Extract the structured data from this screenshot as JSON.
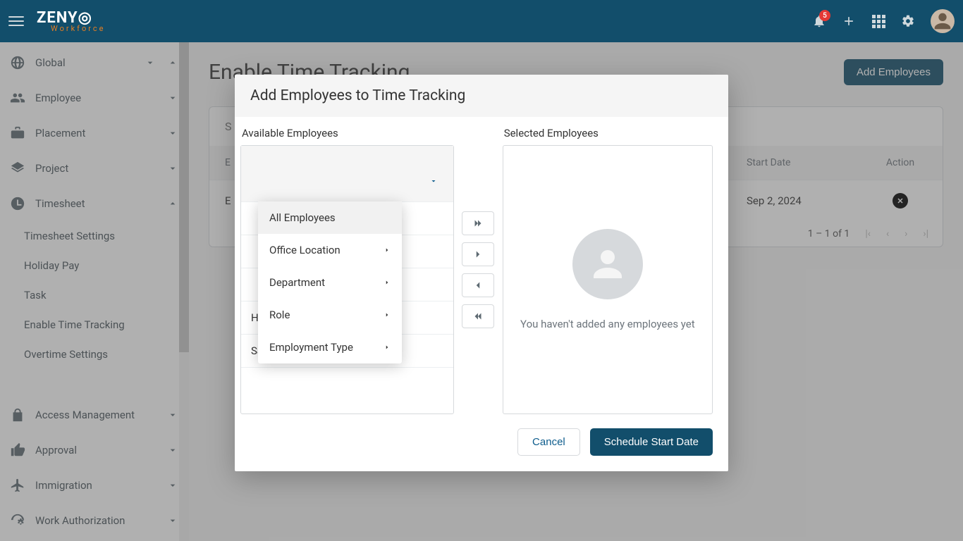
{
  "header": {
    "logo_main": "ZENY",
    "logo_accent": "O",
    "logo_sub": "Workforce",
    "notification_count": "5"
  },
  "sidebar": {
    "items": [
      {
        "icon": "globe",
        "label": "Global",
        "expandable": true,
        "expanded": false
      },
      {
        "icon": "people",
        "label": "Employee",
        "expandable": true,
        "expanded": false
      },
      {
        "icon": "briefcase",
        "label": "Placement",
        "expandable": true,
        "expanded": false
      },
      {
        "icon": "layers",
        "label": "Project",
        "expandable": true,
        "expanded": false
      },
      {
        "icon": "clock",
        "label": "Timesheet",
        "expandable": true,
        "expanded": true,
        "children": [
          "Timesheet Settings",
          "Holiday Pay",
          "Task",
          "Enable Time Tracking",
          "Overtime Settings"
        ]
      },
      {
        "icon": "lock",
        "label": "Access Management",
        "expandable": true,
        "expanded": false
      },
      {
        "icon": "thumb",
        "label": "Approval",
        "expandable": true,
        "expanded": false
      },
      {
        "icon": "plane",
        "label": "Immigration",
        "expandable": true,
        "expanded": false
      },
      {
        "icon": "world-gear",
        "label": "Work Authorization",
        "expandable": true,
        "expanded": false
      }
    ]
  },
  "page": {
    "title": "Enable Time Tracking",
    "add_button": "Add Employees",
    "search_placeholder": "S",
    "table": {
      "col_name": "E",
      "col_start": "Start Date",
      "col_action": "Action",
      "rows": [
        {
          "name": "E",
          "start": "Sep 2, 2024"
        }
      ],
      "page_label": "1 – 1 of 1"
    }
  },
  "modal": {
    "title": "Add Employees to Time Tracking",
    "available_label": "Available Employees",
    "selected_label": "Selected Employees",
    "empty_text": "You haven't added any employees yet",
    "cancel": "Cancel",
    "schedule": "Schedule Start Date",
    "employees": [
      "Hemalatha S",
      "Salma Mofika M"
    ]
  },
  "dropdown": {
    "items": [
      {
        "label": "All Employees",
        "sub": false,
        "highlight": true
      },
      {
        "label": "Office Location",
        "sub": true
      },
      {
        "label": "Department",
        "sub": true
      },
      {
        "label": "Role",
        "sub": true
      },
      {
        "label": "Employment Type",
        "sub": true
      }
    ]
  }
}
